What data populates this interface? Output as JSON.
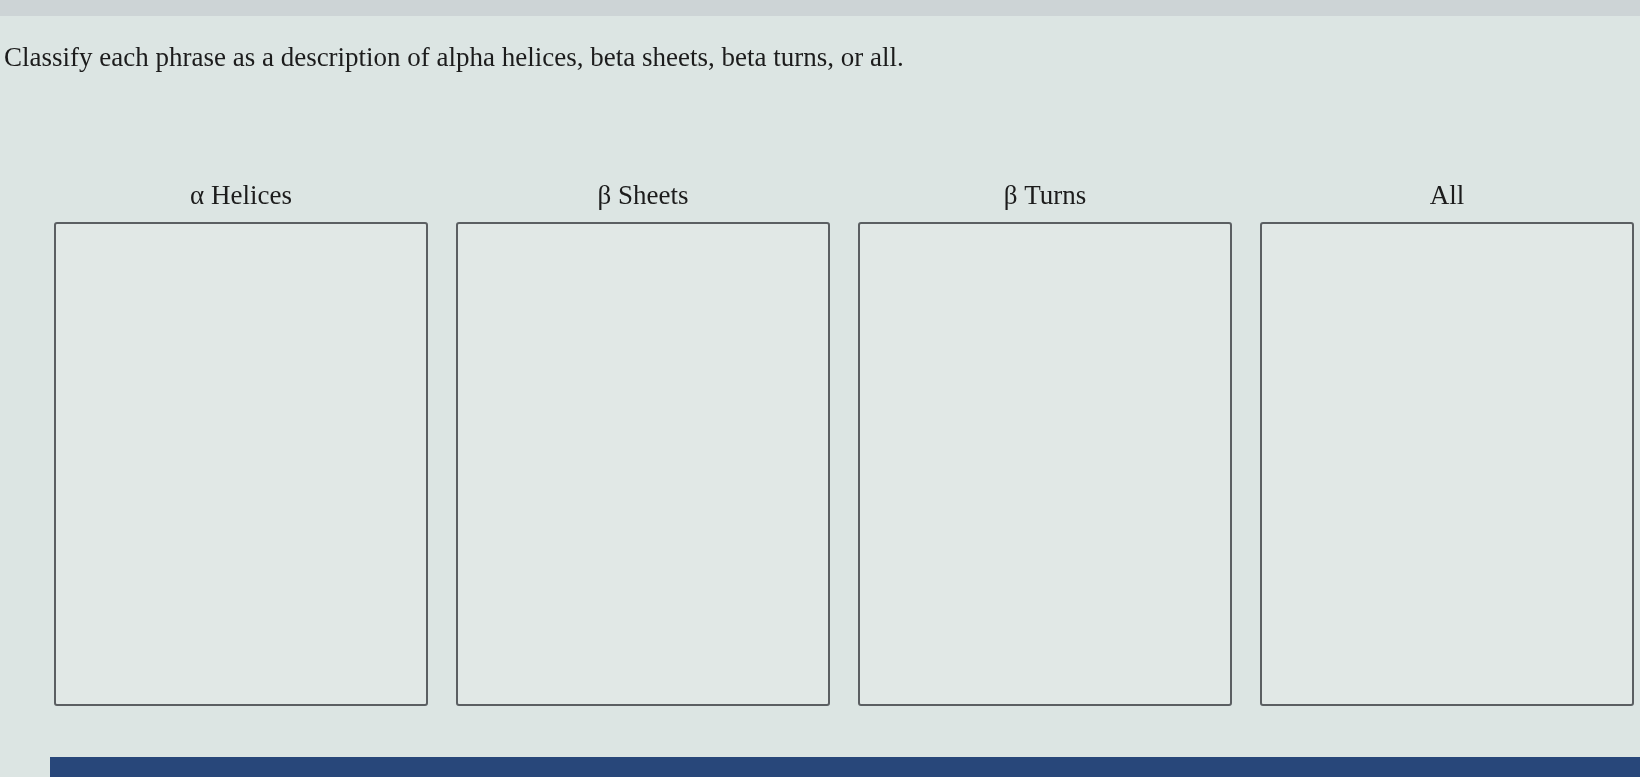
{
  "question": {
    "prompt": "Classify each phrase as a description of alpha helices, beta sheets, beta turns, or all."
  },
  "bins": [
    {
      "label": "α Helices"
    },
    {
      "label": "β Sheets"
    },
    {
      "label": "β Turns"
    },
    {
      "label": "All"
    }
  ]
}
